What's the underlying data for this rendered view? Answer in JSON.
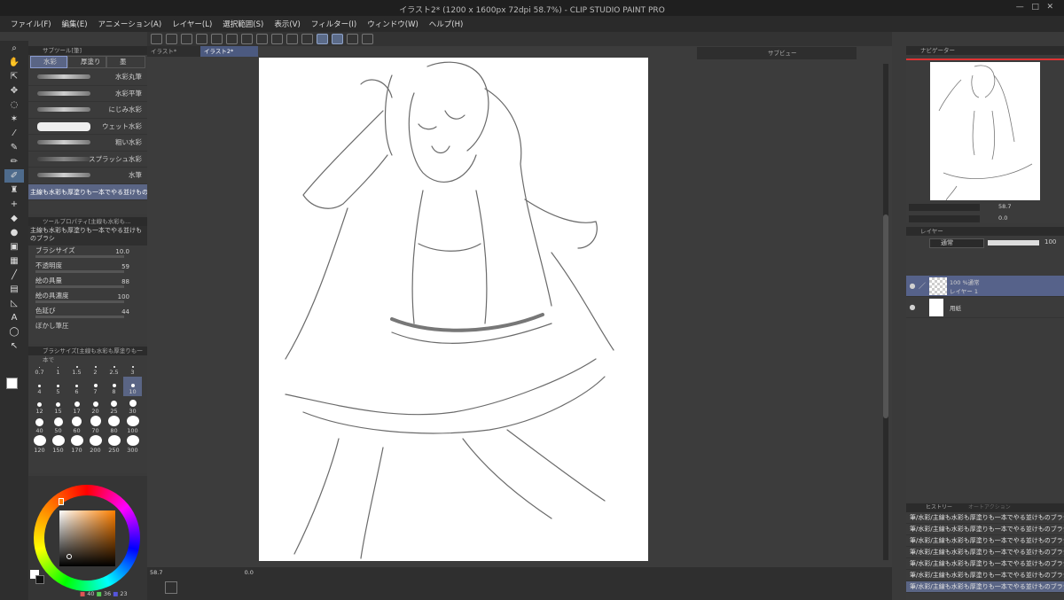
{
  "window": {
    "title": "イラスト2* (1200 x 1600px 72dpi 58.7%) - CLIP STUDIO PAINT PRO"
  },
  "menu": [
    "ファイル(F)",
    "編集(E)",
    "アニメーション(A)",
    "レイヤー(L)",
    "選択範囲(S)",
    "表示(V)",
    "フィルター(I)",
    "ウィンドウ(W)",
    "ヘルプ(H)"
  ],
  "tabs": {
    "doc1": "イラスト*",
    "doc2": "イラスト2*",
    "subview": "サブビュー"
  },
  "subtool": {
    "title": "サブツール[筆]",
    "groups": [
      "水彩",
      "厚塗り",
      "墨"
    ],
    "brushes": [
      "水彩丸筆",
      "水彩平筆",
      "にじみ水彩",
      "ウェット水彩",
      "粗い水彩",
      "スプラッシュ水彩",
      "水筆"
    ],
    "selected": "主線も水彩も厚塗りも一本でやる並けものブラシ"
  },
  "toolprop": {
    "title": "ツールプロパティ[主線も水彩も...",
    "name": "主線も水彩も厚塗りも一本でやる並けものブラシ",
    "props": [
      {
        "label": "ブラシサイズ",
        "value": "10.0"
      },
      {
        "label": "不透明度",
        "value": "59"
      },
      {
        "label": "絵の具量",
        "value": "88"
      },
      {
        "label": "絵の具濃度",
        "value": "100"
      },
      {
        "label": "色延び",
        "value": "44"
      }
    ],
    "extra": "ぼかし筆圧"
  },
  "brushsize": {
    "title": "ブラシサイズ[主線も水彩も厚塗りも一本で",
    "sizes": [
      "0.7",
      "1",
      "1.5",
      "2",
      "2.5",
      "3",
      "4",
      "5",
      "6",
      "7",
      "8",
      "10",
      "12",
      "15",
      "17",
      "20",
      "25",
      "30",
      "40",
      "50",
      "60",
      "70",
      "80",
      "100",
      "120",
      "150",
      "170",
      "200",
      "250",
      "300"
    ],
    "selected": "10"
  },
  "color": {
    "h": "40",
    "s": "36",
    "v": "23",
    "main": "#ffffff",
    "sub": "#1a1a1a"
  },
  "navigator": {
    "title": "ナビゲーター",
    "zoom": "58.7",
    "angle": "0.0"
  },
  "layers": {
    "title": "レイヤー",
    "blend": "通常",
    "opacity": "100",
    "items": [
      {
        "mode": "100 %通常",
        "name": "レイヤー 1"
      },
      {
        "mode": "",
        "name": "用紙"
      }
    ]
  },
  "history": {
    "tabs": [
      "ヒストリー",
      "オートアクション"
    ],
    "item": "筆/水彩/主線も水彩も厚塗りも一本でやる並けものブラシ",
    "count": 7
  },
  "status": {
    "zoom": "58.7",
    "angle": "0.0"
  }
}
